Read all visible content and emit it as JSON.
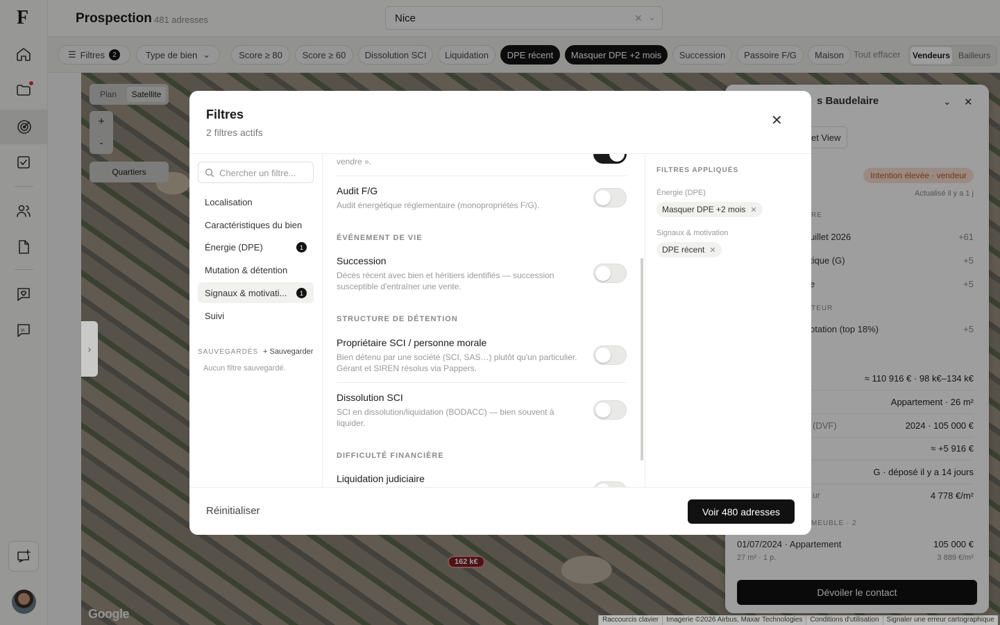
{
  "sidebar": {
    "logo": "F"
  },
  "topbar": {
    "title": "Prospection",
    "count": "481 adresses",
    "city_value": "Nice"
  },
  "chips": {
    "filters_label": "Filtres",
    "filters_badge": "2",
    "type_label": "Type de bien",
    "items": [
      "Score ≥ 80",
      "Score ≥ 60",
      "Dissolution SCI",
      "Liquidation",
      "DPE récent",
      "Masquer DPE +2 mois",
      "Succession",
      "Passoire F/G",
      "Maison"
    ],
    "clear": "Tout effacer",
    "seg_a": "Vendeurs",
    "seg_b": "Bailleurs"
  },
  "map": {
    "plan": "Plan",
    "satellite": "Satellite",
    "zoom_in": "+",
    "zoom_out": "-",
    "quartiers": "Quartiers",
    "expand": "›",
    "price": "162 k€",
    "google": "Google",
    "attrib": [
      "Raccourcis clavier",
      "Imagerie ©2026 Airbus, Maxar Technologies",
      "Conditions d'utilisation",
      "Signaler une erreur cartographique"
    ]
  },
  "panel": {
    "title": "s Baudelaire",
    "street_view": "et View",
    "intent": "Intention élevée · vendeur",
    "updated": "Actualisé il y a 1 j",
    "sec1": "RE",
    "r1": "uillet 2026",
    "r1v": "+61",
    "r2": "tique (G)",
    "r2v": "+5",
    "r3": "e",
    "r3v": "+5",
    "sec2": "TEUR",
    "r4": "otation (top 18%)",
    "r4v": "+5",
    "v1": "≈ 110 916 € · 98 k€–134 k€",
    "v2": "Appartement · 26 m²",
    "l3": "(DVF)",
    "v3": "2024 · 105 000 €",
    "v4": "≈ +5 916 €",
    "v5": "G · déposé il y a 14 jours",
    "l6": "ur",
    "v6": "4 778 €/m²",
    "sec3": "MEUBLE · 2",
    "sale_title": "01/07/2024 · Appartement",
    "sale_price": "105 000 €",
    "sale_sub": "27 m² · 1 p.",
    "sale_ppm": "3 889 €/m²",
    "cta": "Dévoiler le contact"
  },
  "modal": {
    "title": "Filtres",
    "subtitle": "2 filtres actifs",
    "search_placeholder": "Chercher un filtre...",
    "nav": [
      {
        "label": "Localisation",
        "badge": ""
      },
      {
        "label": "Caractéristiques du bien",
        "badge": ""
      },
      {
        "label": "Énergie (DPE)",
        "badge": "1"
      },
      {
        "label": "Mutation & détention",
        "badge": ""
      },
      {
        "label": "Signaux & motivati...",
        "badge": "1"
      },
      {
        "label": "Suivi",
        "badge": ""
      }
    ],
    "saved_header": "SAUVEGARDÉS",
    "saved_add": "+ Sauvegarder",
    "saved_empty": "Aucun filtre sauvegardé.",
    "partial_desc": "vendre ».",
    "audit": {
      "title": "Audit F/G",
      "desc": "Audit énergétique réglementaire (monopropriétés F/G)."
    },
    "sec_vie": "ÉVÉNEMENT DE VIE",
    "succession": {
      "title": "Succession",
      "desc": "Décès récent avec bien et héritiers identifiés — succession susceptible d'entraîner une vente."
    },
    "sec_detention": "STRUCTURE DE DÉTENTION",
    "sci": {
      "title": "Propriétaire SCI / personne morale",
      "desc": "Bien détenu par une société (SCI, SAS…) plutôt qu'un particulier. Gérant et SIREN résolus via Pappers."
    },
    "dissolution": {
      "title": "Dissolution SCI",
      "desc": "SCI en dissolution/liquidation (BODACC) — bien souvent à liquider."
    },
    "sec_fin": "DIFFICULTÉ FINANCIÈRE",
    "liquidation": {
      "title": "Liquidation judiciaire"
    },
    "applied_header": "FILTRES APPLIQUÉS",
    "group1": "Énergie (DPE)",
    "tag1": "Masquer DPE +2 mois",
    "group2": "Signaux & motivation",
    "tag2": "DPE récent",
    "reset": "Réinitialiser",
    "submit": "Voir 480 adresses"
  }
}
